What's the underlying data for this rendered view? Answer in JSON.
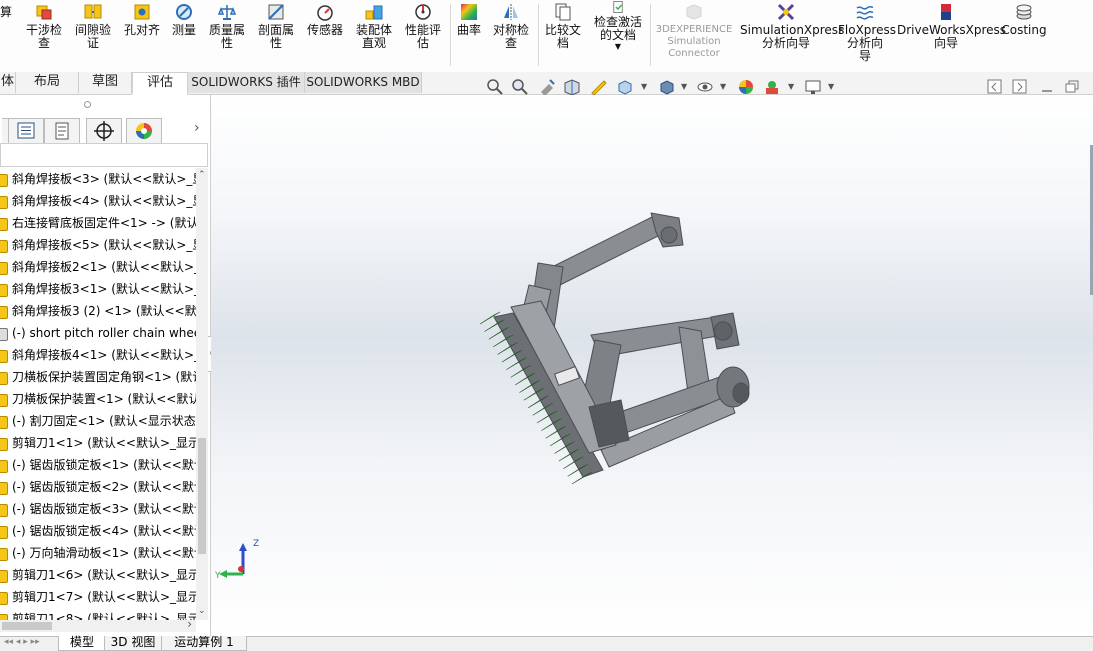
{
  "ribbon": {
    "partial_first": "算",
    "buttons": [
      {
        "label": "干涉检\n查"
      },
      {
        "label": "间隙验\n证"
      },
      {
        "label": "孔对齐"
      },
      {
        "label": "测量"
      },
      {
        "label": "质量属\n性"
      },
      {
        "label": "剖面属\n性"
      },
      {
        "label": "传感器"
      },
      {
        "label": "装配体\n直观"
      },
      {
        "label": "性能评\n估"
      },
      {
        "label": "曲率"
      },
      {
        "label": "对称检\n查"
      },
      {
        "label": "比较文\n档"
      },
      {
        "label": "检查激活\n的文档"
      },
      {
        "label": "3DEXPERIENCE\nSimulation\nConnector"
      },
      {
        "label": "SimulationXpress\n分析向导"
      },
      {
        "label": "FloXpress\n分析向\n导"
      },
      {
        "label": "DriveWorksXpress\n向导"
      },
      {
        "label": "Costing"
      }
    ]
  },
  "tabs": [
    "体",
    "布局",
    "草图",
    "评估",
    "SOLIDWORKS 插件",
    "SOLIDWORKS MBD"
  ],
  "active_tab": "评估",
  "tree": {
    "items": [
      {
        "label": "斜角焊接板<3> (默认<<默认>_显"
      },
      {
        "label": "斜角焊接板<4> (默认<<默认>_显"
      },
      {
        "label": "右连接臂底板固定件<1> -> (默认"
      },
      {
        "label": "斜角焊接板<5> (默认<<默认>_显"
      },
      {
        "label": "斜角焊接板2<1> (默认<<默认>_显"
      },
      {
        "label": "斜角焊接板3<1> (默认<<默认>_显"
      },
      {
        "label": "斜角焊接板3 (2) <1> (默认<<默"
      },
      {
        "label": "(-) short pitch roller chain whee"
      },
      {
        "label": "斜角焊接板4<1> (默认<<默认>_显"
      },
      {
        "label": "刀横板保护装置固定角钢<1> (默认"
      },
      {
        "label": "刀横板保护装置<1> (默认<<默认"
      },
      {
        "label": "(-) 割刀固定<1> (默认<显示状态-"
      },
      {
        "label": "剪辑刀1<1> (默认<<默认>_显示"
      },
      {
        "label": "(-) 锯齿版锁定板<1> (默认<<默认"
      },
      {
        "label": "(-) 锯齿版锁定板<2> (默认<<默认"
      },
      {
        "label": "(-) 锯齿版锁定板<3> (默认<<默认"
      },
      {
        "label": "(-) 锯齿版锁定板<4> (默认<<默认"
      },
      {
        "label": "(-) 万向轴滑动板<1> (默认<<默认"
      },
      {
        "label": "剪辑刀1<6> (默认<<默认>_显示"
      },
      {
        "label": "剪辑刀1<7> (默认<<默认>_显示"
      },
      {
        "label": "剪辑刀1<8> (默认<<默认>_显示"
      }
    ]
  },
  "bottom_tabs": [
    "模型",
    "3D 视图",
    "运动算例 1"
  ],
  "triad": {
    "y_label": "Y",
    "z_label": "Z"
  },
  "colors": {
    "accent": "#e8a000",
    "icon_blue": "#2a6fb8",
    "part_gray": "#7a7d82",
    "blade_green": "#2f8a2f"
  }
}
